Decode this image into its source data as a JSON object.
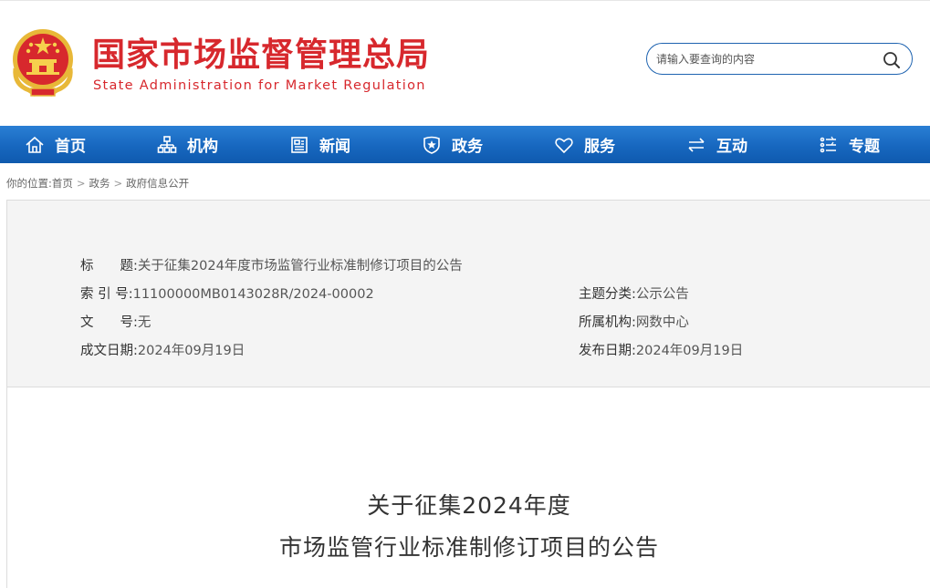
{
  "header": {
    "title_cn": "国家市场监督管理总局",
    "title_en": "State Administration for Market Regulation",
    "emblem_icon": "national-emblem-icon",
    "search": {
      "placeholder": "请输入要查询的内容",
      "value": ""
    }
  },
  "nav": {
    "items": [
      {
        "label": "首页",
        "icon": "home-icon"
      },
      {
        "label": "机构",
        "icon": "org-chart-icon"
      },
      {
        "label": "新闻",
        "icon": "newspaper-icon"
      },
      {
        "label": "政务",
        "icon": "shield-icon"
      },
      {
        "label": "服务",
        "icon": "heart-icon"
      },
      {
        "label": "互动",
        "icon": "exchange-arrows-icon"
      },
      {
        "label": "专题",
        "icon": "topic-list-icon"
      }
    ]
  },
  "breadcrumb": {
    "prefix": "你的位置:",
    "items": [
      "首页",
      "政务",
      "政府信息公开"
    ],
    "separator": ">"
  },
  "info": {
    "title_label": "标　　题:",
    "title_value": "关于征集2024年度市场监管行业标准制修订项目的公告",
    "index_label": "索 引 号:",
    "index_value": "11100000MB0143028R/2024-00002",
    "category_label": "主题分类:",
    "category_value": "公示公告",
    "doc_no_label": "文　　号:",
    "doc_no_value": "无",
    "agency_label": "所属机构:",
    "agency_value": "网数中心",
    "created_label": "成文日期:",
    "created_value": "2024年09月19日",
    "published_label": "发布日期:",
    "published_value": "2024年09月19日"
  },
  "article": {
    "title_line1": "关于征集2024年度",
    "title_line2": "市场监管行业标准制修订项目的公告"
  },
  "colors": {
    "brand_red": "#d7282d",
    "nav_blue": "#1767bf",
    "search_border": "#1e63b0",
    "panel_bg": "#f4f4f4"
  }
}
